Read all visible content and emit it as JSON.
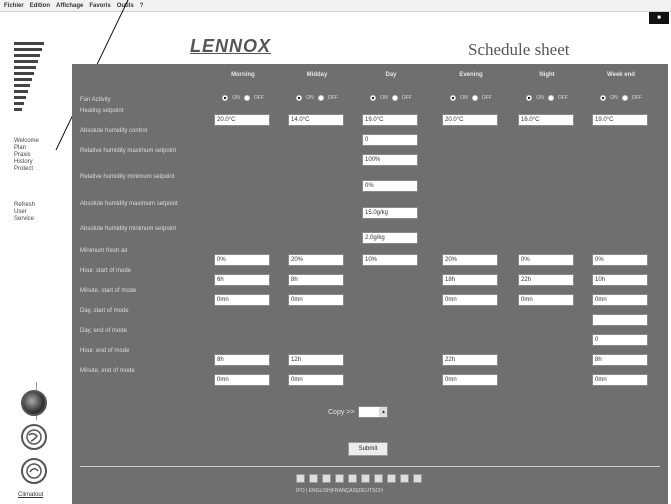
{
  "menubar": {
    "items": [
      "Fichier",
      "Edition",
      "Affichage",
      "Favoris",
      "Outils",
      "?"
    ]
  },
  "header": {
    "brand": "LENNOX",
    "title": "Schedule sheet"
  },
  "sidebar": {
    "nav_primary": [
      "Welcome",
      "Plan",
      "Praxis",
      "History",
      "Protect"
    ],
    "nav_secondary": [
      "Refresh",
      "User",
      "Service"
    ],
    "bottom_link": "Climatout"
  },
  "columns": [
    "Morning",
    "Midday",
    "Day",
    "Evening",
    "Night",
    "Week end"
  ],
  "fan_row": {
    "label": "Fan Activity",
    "on_label": "ON",
    "off_label": "OFF"
  },
  "rows": [
    {
      "label": "Heating setpoint",
      "values": [
        "20.0°C",
        "14.0°C",
        "19.0°C",
        "20.0°C",
        "16.0°C",
        "19.0°C"
      ]
    },
    {
      "label": "Absolute humidity control",
      "values": [
        null,
        null,
        "0",
        null,
        null,
        null
      ]
    },
    {
      "label": "Relative humidity maximum setpoint",
      "values": [
        null,
        null,
        "100%",
        null,
        null,
        null
      ]
    },
    {
      "label": "Relative humidity minimum setpoint",
      "values": [
        null,
        null,
        "0%",
        null,
        null,
        null
      ]
    },
    {
      "label": "Absolute humidity maximum setpoint",
      "values": [
        null,
        null,
        "15.0g/kg",
        null,
        null,
        null
      ]
    },
    {
      "label": "Absolute humidity minimum setpoint",
      "values": [
        null,
        null,
        "2.0g/kg",
        null,
        null,
        null
      ]
    },
    {
      "label": "Minimum fresh air",
      "values": [
        "0%",
        "20%",
        "10%",
        "20%",
        "0%",
        "0%"
      ]
    },
    {
      "label": "Hour, start of mode",
      "values": [
        "6h",
        "8h",
        null,
        "18h",
        "22h",
        "10h"
      ]
    },
    {
      "label": "Minute, start of mode",
      "values": [
        "0mn",
        "0mn",
        null,
        "0mn",
        "0mn",
        "0mn"
      ]
    },
    {
      "label": "Day, start of mode",
      "values": [
        null,
        null,
        null,
        null,
        null,
        ""
      ]
    },
    {
      "label": "Day, end of mode",
      "values": [
        null,
        null,
        null,
        null,
        null,
        "0"
      ]
    },
    {
      "label": "Hour, end of mode",
      "values": [
        "8h",
        "12h",
        null,
        "22h",
        null,
        "8h"
      ]
    },
    {
      "label": "Minute, end of mode",
      "values": [
        "0mn",
        "0mn",
        null,
        "0mn",
        null,
        "0mn"
      ]
    }
  ],
  "copy": {
    "label": "Copy >>"
  },
  "submit": {
    "label": "Submit"
  },
  "footer": {
    "links_text": "IPO | ENGLISH|FRANÇAIS|DEUTSCH"
  },
  "colors": {
    "panel": "#6f6f6f",
    "page": "#ffffff",
    "field": "#ffffff"
  }
}
